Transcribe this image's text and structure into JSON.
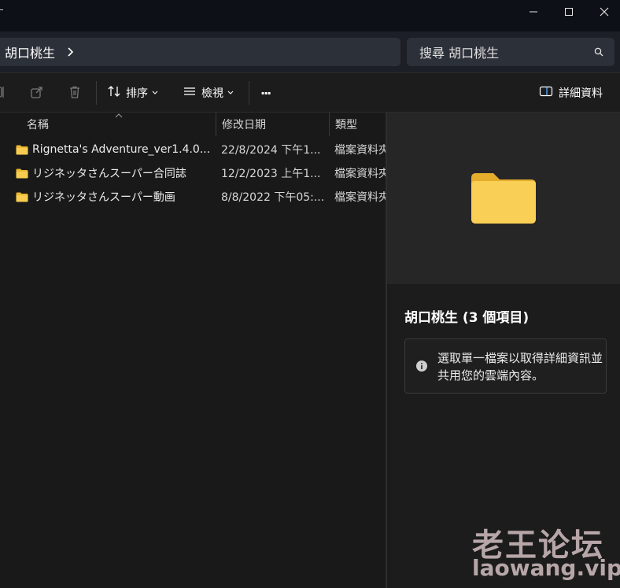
{
  "breadcrumb": {
    "current": "胡口桃生"
  },
  "search": {
    "text": "搜尋 胡口桃生"
  },
  "toolbar": {
    "sort_label": "排序",
    "view_label": "檢視",
    "more_label": "···",
    "details_label": "詳細資料"
  },
  "columns": {
    "name": "名稱",
    "date": "修改日期",
    "type": "類型"
  },
  "files": [
    {
      "name": "Rignetta's Adventure_ver1.4.0...",
      "date": "22/8/2024 下午1...",
      "type": "檔案資料夾"
    },
    {
      "name": "リジネッタさんスーパー合同誌",
      "date": "12/2/2023 上午1...",
      "type": "檔案資料夾"
    },
    {
      "name": "リジネッタさんスーパー動画",
      "date": "8/8/2022 下午05:...",
      "type": "檔案資料夾"
    }
  ],
  "details_pane": {
    "title": "胡口桃生 (3 個項目)",
    "info": "選取單一檔案以取得詳細資訊並共用您的雲端內容。"
  },
  "watermark": {
    "title": "老王论坛",
    "url": "laowang.vip"
  },
  "colors": {
    "folder": "#f5c542",
    "accent": "#4aa3ff"
  },
  "icons": {
    "minimize": "minimize-icon",
    "maximize": "maximize-icon",
    "close": "close-icon",
    "chevron": "chevron-right-icon",
    "search": "search-icon",
    "share": "share-icon",
    "delete": "trash-icon",
    "sort": "sort-icon",
    "view": "view-list-icon",
    "details": "details-pane-icon",
    "folder": "folder-icon",
    "info": "info-icon"
  }
}
